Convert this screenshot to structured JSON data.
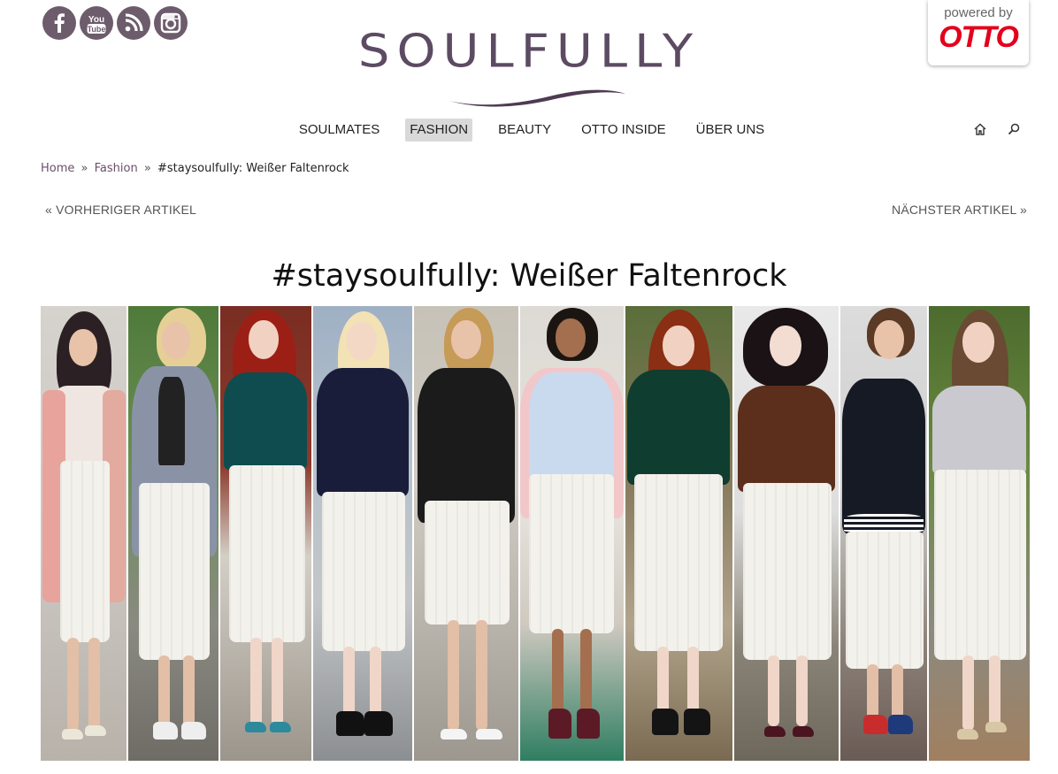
{
  "social": [
    {
      "name": "facebook-icon"
    },
    {
      "name": "youtube-icon",
      "label": "You Tube"
    },
    {
      "name": "rss-icon"
    },
    {
      "name": "instagram-icon"
    }
  ],
  "logo": {
    "text": "SOULFULLY"
  },
  "partner": {
    "powered": "powered by",
    "brand": "OTTO"
  },
  "nav": {
    "items": [
      "SOULMATES",
      "FASHION",
      "BEAUTY",
      "OTTO INSIDE",
      "ÜBER UNS"
    ],
    "active": "FASHION"
  },
  "breadcrumb": {
    "home": "Home",
    "sep": "»",
    "category": "Fashion",
    "current": "#staysoulfully: Weißer Faltenrock"
  },
  "pager": {
    "prev": "« VORHERIGER ARTIKEL",
    "next": "NÄCHSTER ARTIKEL »"
  },
  "article": {
    "title": "#staysoulfully: Weißer Faltenrock"
  },
  "colors": {
    "brand_purple": "#5c4b63",
    "social_bg": "#6d5c6b",
    "otto_red": "#e3001b",
    "nav_active_bg": "#d9d9d9"
  }
}
